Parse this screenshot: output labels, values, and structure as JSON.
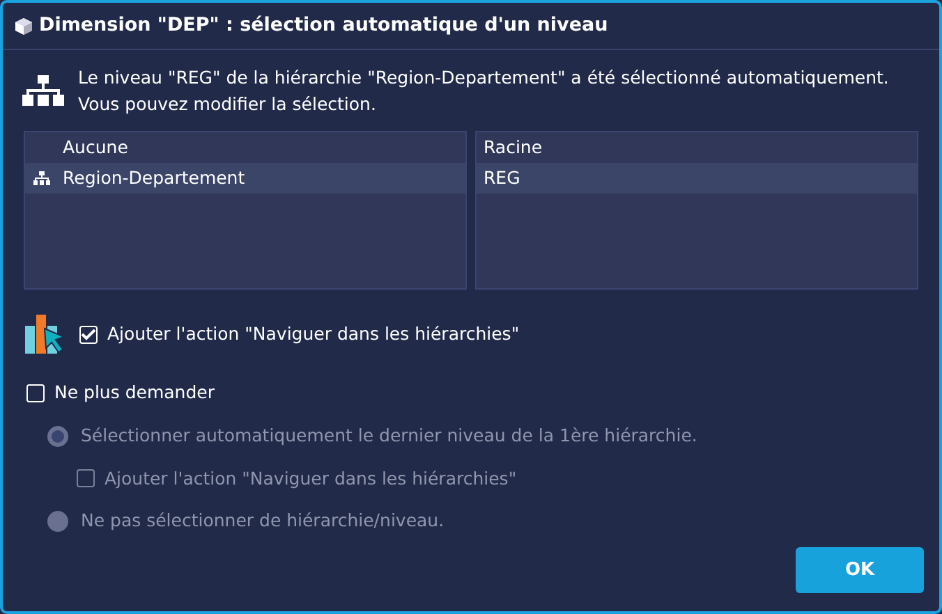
{
  "window": {
    "title": "Dimension \"DEP\" : sélection automatique d'un niveau"
  },
  "message": [
    "Le niveau \"REG\" de la hiérarchie \"Region-Departement\" a été sélectionné automatiquement.",
    "Vous pouvez modifier la sélection."
  ],
  "hierarchies": [
    {
      "label": "Aucune",
      "selected": false,
      "kind": "none"
    },
    {
      "label": "Region-Departement",
      "selected": true,
      "kind": "hierarchy"
    }
  ],
  "levels": [
    {
      "label": "Racine",
      "selected": false
    },
    {
      "label": "REG",
      "selected": true
    }
  ],
  "navigate_action": {
    "label": "Ajouter l'action \"Naviguer dans les hiérarchies\"",
    "checked": true
  },
  "dont_ask": {
    "label": "Ne plus demander",
    "checked": false
  },
  "options": [
    {
      "kind": "radio",
      "label": "Sélectionner automatiquement le dernier niveau de la 1ère hiérarchie.",
      "selected": true,
      "disabled": true
    },
    {
      "kind": "checkbox",
      "label": "Ajouter l'action \"Naviguer dans les hiérarchies\"",
      "checked": false,
      "disabled": true
    },
    {
      "kind": "radio",
      "label": "Ne pas sélectionner de hiérarchie/niveau.",
      "selected": false,
      "disabled": true
    }
  ],
  "buttons": [
    {
      "label": "OK"
    }
  ]
}
